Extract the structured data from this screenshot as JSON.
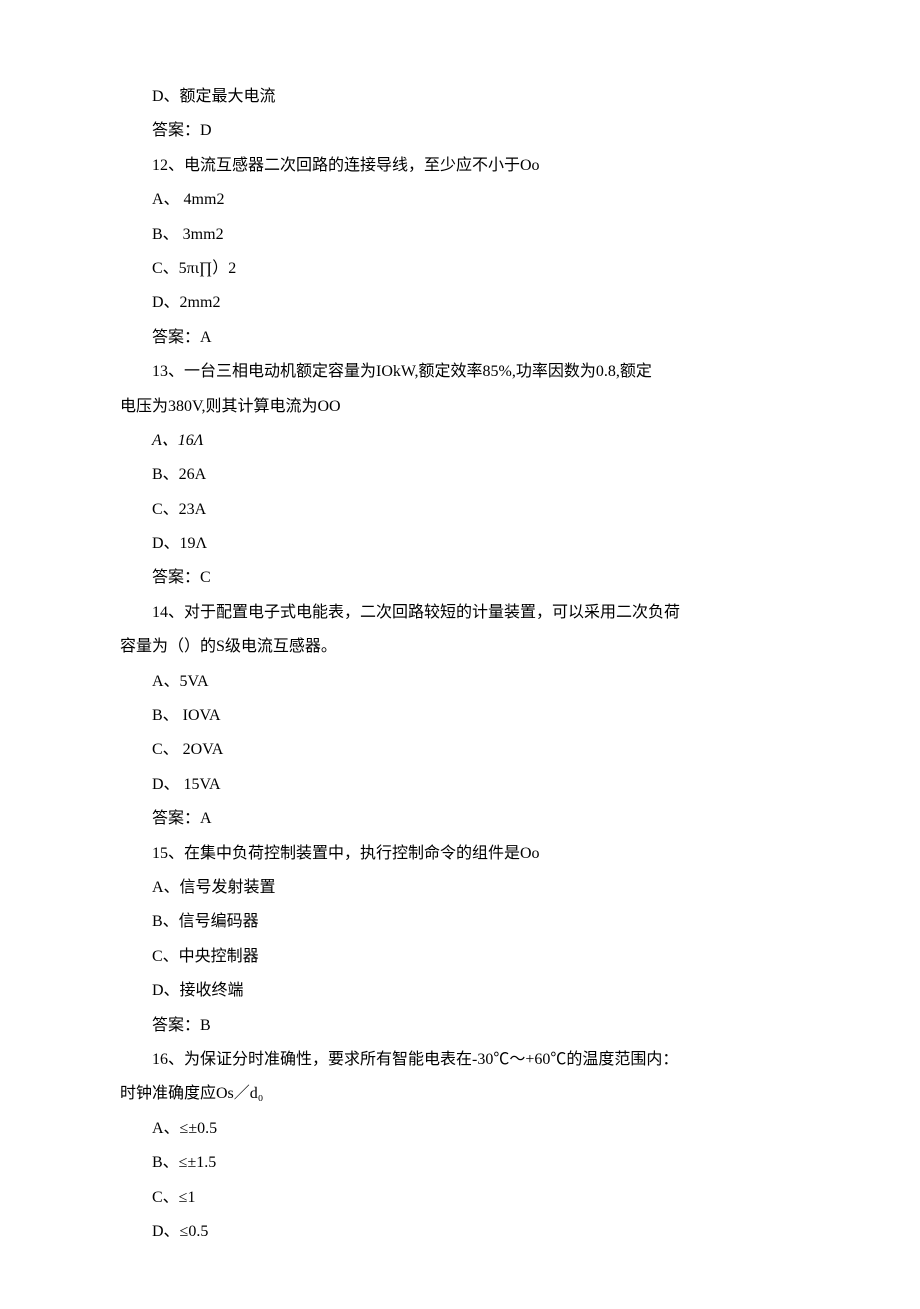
{
  "lines": [
    {
      "text": "D、额定最大电流",
      "indent": true
    },
    {
      "text": "答案：D",
      "indent": true
    },
    {
      "text": "12、电流互感器二次回路的连接导线，至少应不小于Oo",
      "indent": true
    },
    {
      "text": "A、 4mm2",
      "indent": true
    },
    {
      "text": "B、 3mm2",
      "indent": true
    },
    {
      "text": "C、5πι∏）2",
      "indent": true
    },
    {
      "text": "D、2mm2",
      "indent": true
    },
    {
      "text": "答案：A",
      "indent": true
    },
    {
      "text": "13、一台三相电动机额定容量为IOkW,额定效率85%,功率因数为0.8,额定",
      "indent": true
    },
    {
      "text": "电压为380V,则其计算电流为OO",
      "indent": false
    },
    {
      "text": "A、16Λ",
      "indent": true,
      "italic": true
    },
    {
      "text": "B、26A",
      "indent": true
    },
    {
      "text": "C、23A",
      "indent": true
    },
    {
      "text": "D、19Λ",
      "indent": true
    },
    {
      "text": "答案：C",
      "indent": true
    },
    {
      "text": "14、对于配置电子式电能表，二次回路较短的计量装置，可以采用二次负荷",
      "indent": true
    },
    {
      "text": "容量为（）的S级电流互感器。",
      "indent": false
    },
    {
      "text": "A、5VA",
      "indent": true
    },
    {
      "text": "B、 IOVA",
      "indent": true
    },
    {
      "text": "C、 2OVA",
      "indent": true
    },
    {
      "text": "D、 15VA",
      "indent": true
    },
    {
      "text": "答案：A",
      "indent": true
    },
    {
      "text": "15、在集中负荷控制装置中，执行控制命令的组件是Oo",
      "indent": true
    },
    {
      "text": "A、信号发射装置",
      "indent": true
    },
    {
      "text": "B、信号编码器",
      "indent": true
    },
    {
      "text": "C、中央控制器",
      "indent": true
    },
    {
      "text": "D、接收终端",
      "indent": true
    },
    {
      "text": "答案：B",
      "indent": true
    },
    {
      "text": "16、为保证分时准确性，要求所有智能电表在-30℃～+60℃的温度范围内：",
      "indent": true
    },
    {
      "text": "时钟准确度应Os／d₀",
      "indent": false
    },
    {
      "text": "A、≤±0.5",
      "indent": true
    },
    {
      "text": "B、≤±1.5",
      "indent": true
    },
    {
      "text": "C、≤1",
      "indent": true
    },
    {
      "text": "D、≤0.5",
      "indent": true
    }
  ]
}
